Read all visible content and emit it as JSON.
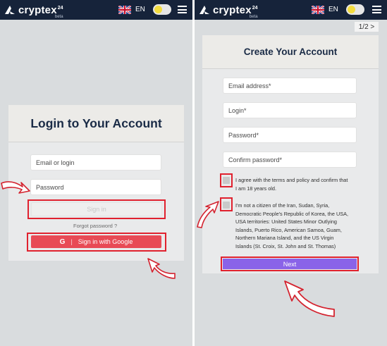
{
  "header": {
    "brand": "cryptex",
    "brand_superscript": "24",
    "brand_tag": "beta",
    "language": "EN"
  },
  "login": {
    "title": "Login to Your Account",
    "email_placeholder": "Email or login",
    "password_placeholder": "Password",
    "sign_in_label": "Sign in",
    "forgot_password_label": "Forgot password ?",
    "google_icon_letter": "G",
    "google_separator": "|",
    "google_label": "Sign in with Google"
  },
  "register": {
    "pager": "1/2 >",
    "title": "Create Your Account",
    "email_placeholder": "Email address*",
    "login_placeholder": "Login*",
    "password_placeholder": "Password*",
    "confirm_placeholder": "Confirm password*",
    "terms_line1": "I agree with the terms and policy and confirm that",
    "terms_line2": "I am 18 years old.",
    "citizen_lines": [
      "I'm not a citizen of the Iran, Sudan, Syria,",
      "Democratic People's Republic of Korea, the USA,",
      "USA territories: United States Minor Outlying",
      "Islands, Puerto Rico, American Samoa, Guam,",
      "Northern Mariana Island, and the US Virgin",
      "Islands (St. Croix, St. John and St. Thomas)"
    ],
    "next_label": "Next"
  },
  "icons": {
    "logo": "cryptex-logo-icon",
    "flag": "uk-flag-icon",
    "theme_toggle": "theme-toggle-icon",
    "menu": "hamburger-menu-icon",
    "annotation_arrow": "hand-drawn-arrow-icon"
  },
  "colors": {
    "topbar": "#16233a",
    "background": "#d9dcde",
    "google_button": "#e84a55",
    "next_button": "#8a63e8",
    "highlight": "#e0212e",
    "title": "#1a2b46"
  }
}
